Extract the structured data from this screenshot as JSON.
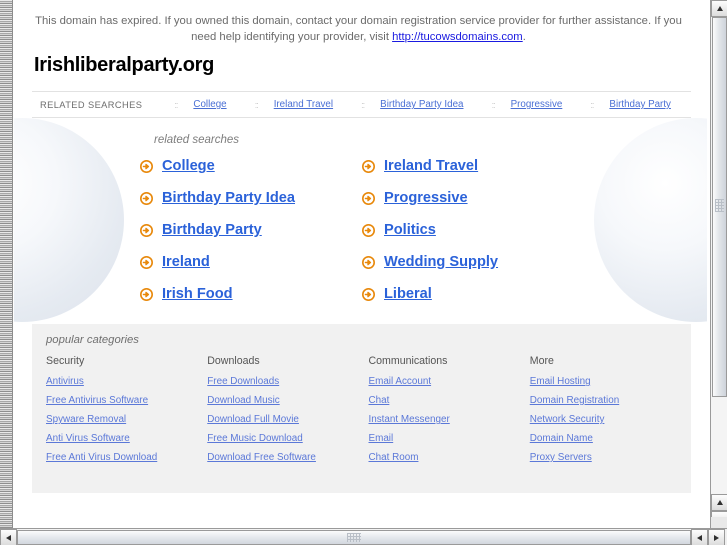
{
  "notice": {
    "text_before": "This domain has expired. If you owned this domain, contact your domain registration service provider for further assistance. If you need help identifying your provider, visit ",
    "link_text": "http://tucowsdomains.com",
    "text_after": "."
  },
  "domain_title": "Irishliberalparty.org",
  "nav": {
    "label": "RELATED SEARCHES",
    "separator": "::",
    "items": [
      {
        "label": "College"
      },
      {
        "label": "Ireland Travel"
      },
      {
        "label": "Birthday Party Idea"
      },
      {
        "label": "Progressive"
      },
      {
        "label": "Birthday Party"
      }
    ]
  },
  "related": {
    "heading": "related searches",
    "items": [
      {
        "label": "College"
      },
      {
        "label": "Ireland Travel"
      },
      {
        "label": "Birthday Party Idea"
      },
      {
        "label": "Progressive"
      },
      {
        "label": "Birthday Party"
      },
      {
        "label": "Politics"
      },
      {
        "label": "Ireland"
      },
      {
        "label": "Wedding Supply"
      },
      {
        "label": "Irish Food"
      },
      {
        "label": "Liberal"
      }
    ]
  },
  "categories": {
    "heading": "popular categories",
    "columns": [
      {
        "title": "Security",
        "links": [
          "Antivirus",
          "Free Antivirus Software",
          "Spyware Removal",
          "Anti Virus Software",
          "Free Anti Virus Download"
        ]
      },
      {
        "title": "Downloads",
        "links": [
          "Free Downloads",
          "Download Music",
          "Download Full Movie",
          "Free Music Download",
          "Download Free Software"
        ]
      },
      {
        "title": "Communications",
        "links": [
          "Email Account",
          "Chat",
          "Instant Messenger",
          "Email",
          "Chat Room"
        ]
      },
      {
        "title": "More",
        "links": [
          "Email Hosting",
          "Domain Registration",
          "Network Security",
          "Domain Name",
          "Proxy Servers"
        ]
      }
    ]
  },
  "colors": {
    "link_blue": "#2b62d9",
    "nav_link_blue": "#4a6fd4",
    "category_link_blue": "#5b78d8",
    "notice_link_blue": "#1a1ae0",
    "arrow_orange": "#e8890c",
    "category_bg": "#f1f1f1",
    "muted_text": "#6f6f6f"
  }
}
